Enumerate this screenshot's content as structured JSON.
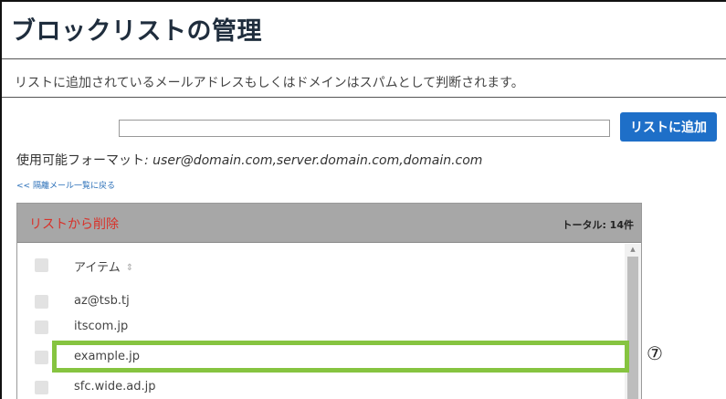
{
  "page": {
    "title": "ブロックリストの管理",
    "description": "リストに追加されているメールアドレスもしくはドメインはスパムとして判断されます。"
  },
  "add_form": {
    "input_value": "",
    "input_placeholder": "",
    "add_button_label": "リストに追加",
    "accent_color": "#1e6fc8"
  },
  "format": {
    "label": "使用可能フォーマット",
    "value": ": user@domain.com,server.domain.com,domain.com"
  },
  "back_link": "<< 隔離メール一覧に戻る",
  "list": {
    "delete_label": "リストから削除",
    "delete_color": "#d8322a",
    "total_label": "トータル: 14件",
    "column_header": "アイテム",
    "sort_icon": "sort-icon",
    "items": [
      {
        "text": "az@tsb.tj",
        "checked": false
      },
      {
        "text": "itscom.jp",
        "checked": false
      },
      {
        "text": "example.jp",
        "checked": false
      },
      {
        "text": "sfc.wide.ad.jp",
        "checked": false
      }
    ]
  },
  "annotation": {
    "marker": "⑦",
    "highlight_color": "#86c440",
    "highlighted_item": "example.jp"
  }
}
